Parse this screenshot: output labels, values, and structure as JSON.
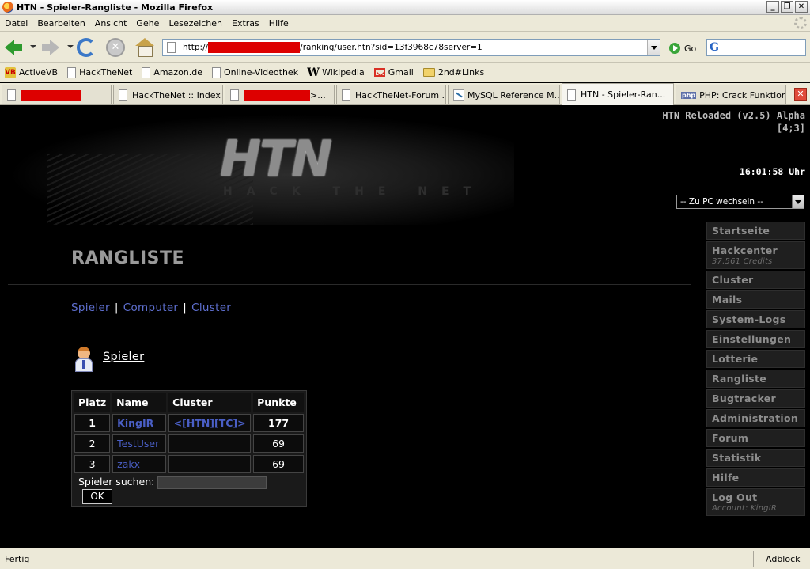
{
  "window": {
    "title": "HTN - Spieler-Rangliste - Mozilla Firefox"
  },
  "menu": [
    "Datei",
    "Bearbeiten",
    "Ansicht",
    "Gehe",
    "Lesezeichen",
    "Extras",
    "Hilfe"
  ],
  "navigation": {
    "url_prefix": "http://",
    "url_suffix": "/ranking/user.htn?sid=13f3968c78server=1",
    "go_label": "Go"
  },
  "bookmarks": [
    {
      "label": "ActiveVB",
      "icon": "activevb-icon"
    },
    {
      "label": "HackTheNet",
      "icon": "page-icon"
    },
    {
      "label": "Amazon.de",
      "icon": "page-icon"
    },
    {
      "label": "Online-Videothek",
      "icon": "page-icon"
    },
    {
      "label": "Wikipedia",
      "icon": "wikipedia-icon"
    },
    {
      "label": "Gmail",
      "icon": "gmail-icon"
    },
    {
      "label": "2nd#Links",
      "icon": "folder-icon"
    }
  ],
  "tabs": [
    {
      "label": "",
      "redacted": true
    },
    {
      "label": "HackTheNet :: Index"
    },
    {
      "label": ">...",
      "redacted": true
    },
    {
      "label": "HackTheNet-Forum ..."
    },
    {
      "label": "MySQL Reference M..."
    },
    {
      "label": "HTN - Spieler-Ran...",
      "active": true
    },
    {
      "label": "PHP: Crack Funktion..."
    }
  ],
  "header": {
    "logo_text": "HTN",
    "logo_subtitle": "HACK THE NET",
    "version_line1": "HTN Reloaded (v2.5) Alpha",
    "version_line2": "[4;3]",
    "clock": "16:01:58 Uhr",
    "pc_select": "-- Zu PC wechseln --"
  },
  "main": {
    "heading": "RANGLISTE",
    "subnav": [
      "Spieler",
      "Computer",
      "Cluster"
    ],
    "section_title": "Spieler",
    "table": {
      "headers": [
        "Platz",
        "Name",
        "Cluster",
        "Punkte"
      ],
      "rows": [
        {
          "platz": "1",
          "name": "KingIR",
          "cluster": "<[HTN][TC]>",
          "punkte": "177"
        },
        {
          "platz": "2",
          "name": "TestUser",
          "cluster": "",
          "punkte": "69"
        },
        {
          "platz": "3",
          "name": "zakx",
          "cluster": "",
          "punkte": "69"
        }
      ],
      "search_label": "Spieler suchen:",
      "ok_label": "OK"
    }
  },
  "sidebar": {
    "items": [
      {
        "label": "Startseite"
      },
      {
        "label": "Hackcenter",
        "sub": "37.561 Credits"
      },
      {
        "label": "Cluster"
      },
      {
        "label": "Mails"
      },
      {
        "label": "System-Logs"
      },
      {
        "label": "Einstellungen"
      },
      {
        "label": "Lotterie"
      },
      {
        "label": "Rangliste"
      },
      {
        "label": "Bugtracker"
      },
      {
        "label": "Administration"
      },
      {
        "label": "Forum"
      },
      {
        "label": "Statistik"
      },
      {
        "label": "Hilfe"
      },
      {
        "label": "Log Out",
        "sub": "Account: KingIR"
      }
    ]
  },
  "status": {
    "text": "Fertig",
    "adblock": "Adblock"
  }
}
